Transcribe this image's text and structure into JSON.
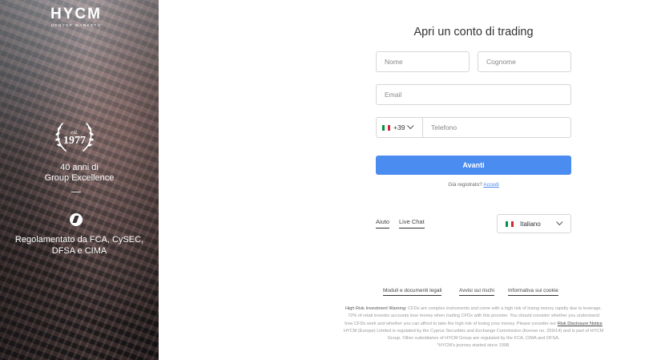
{
  "hero": {
    "logo_main": "HYCM",
    "logo_sub": "HENYEP MARKETS",
    "seal_est": "est.",
    "seal_year": "1977",
    "years_line1": "40 anni di",
    "years_line2": "Group Excellence",
    "regulated_line1": "Regolamentato da FCA, CySEC,",
    "regulated_line2": "DFSA e CIMA"
  },
  "form": {
    "title": "Apri un conto di trading",
    "first_name_placeholder": "Nome",
    "last_name_placeholder": "Cognome",
    "email_placeholder": "Email",
    "phone_prefix": "+39",
    "phone_placeholder": "Telefono",
    "next_label": "Avanti",
    "registered_text": "Già registrato?",
    "login_link": "Accedi"
  },
  "support": {
    "help": "Aiuto",
    "live_chat": "Live Chat",
    "language": "Italiano"
  },
  "footer": {
    "links": [
      "Moduli e documenti legali",
      "Avvisi sui rischi",
      "Informativa sui cookie"
    ],
    "warning_label": "High Risk Investment Warning:",
    "warning_text_1": "CFDs are complex instruments and come with a high risk of losing money rapidly due to leverage.",
    "warning_text_2": "72% of retail investor accounts lose money when trading CFDs with this provider. You should consider whether you understand",
    "warning_text_3": "how CFDs work and whether you can afford to take the high risk of losing your money. Please consider our",
    "risk_link": "Risk Disclosure Notice",
    "warning_text_4": "HYCM (Europe) Limited is regulated by the Cyprus Securities and Exchange Commission (license no. 259/14) and is part of HYCM",
    "warning_text_5": "Group. Other subsidiaries of HYCM Group are regulated by the FCA, CIMA and DFSA.",
    "warning_text_6": "*HYCM's journey started since 1998."
  },
  "colors": {
    "accent": "#4a8cf0",
    "flag_green": "#009246",
    "flag_white": "#ffffff",
    "flag_red": "#ce2b37"
  }
}
